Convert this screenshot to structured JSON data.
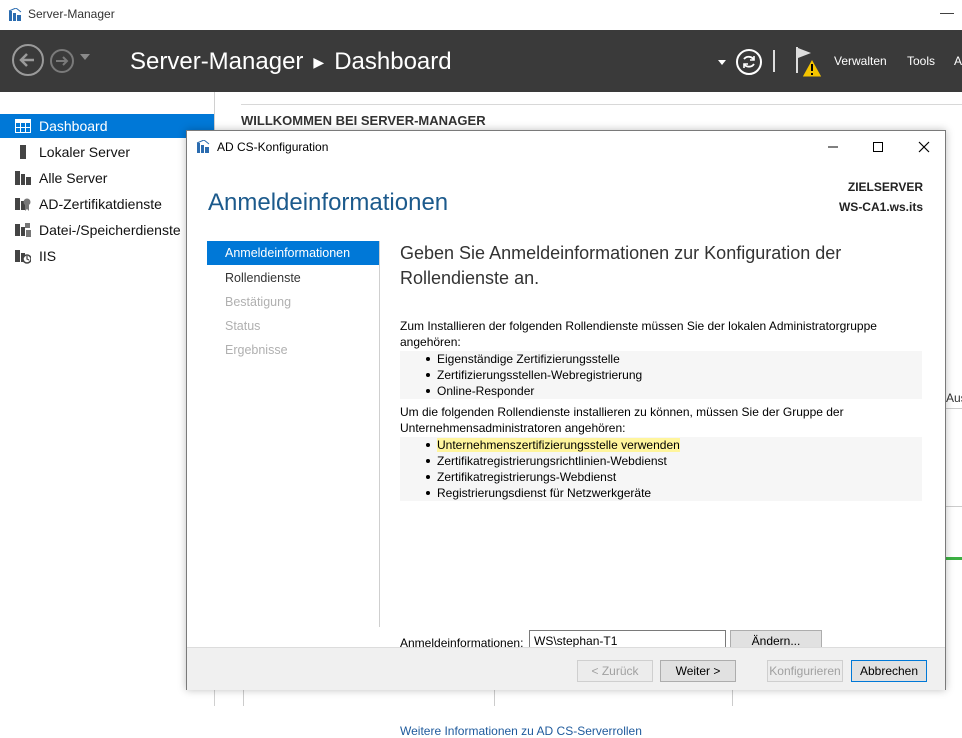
{
  "outer_window": {
    "title": "Server-Manager"
  },
  "header": {
    "title": "Server-Manager",
    "breadcrumb": "Dashboard",
    "menu": [
      "Verwalten",
      "Tools",
      "A"
    ]
  },
  "leftnav": {
    "items": [
      {
        "label": "Dashboard",
        "icon": "dashboard-icon",
        "active": true
      },
      {
        "label": "Lokaler Server",
        "icon": "server-icon"
      },
      {
        "label": "Alle Server",
        "icon": "servers-icon"
      },
      {
        "label": "AD-Zertifikatdienste",
        "icon": "certificate-icon"
      },
      {
        "label": "Datei-/Speicherdienste",
        "icon": "storage-icon"
      },
      {
        "label": "IIS",
        "icon": "iis-icon"
      }
    ]
  },
  "background": {
    "welcome": "WILLKOMMEN BEI SERVER-MANAGER",
    "right_fragment": "Aus"
  },
  "dialog": {
    "title": "AD CS-Konfiguration",
    "heading": "Anmeldeinformationen",
    "target_label": "ZIELSERVER",
    "target_value": "WS-CA1.ws.its",
    "steps": [
      {
        "label": "Anmeldeinformationen",
        "state": "active"
      },
      {
        "label": "Rollendienste",
        "state": "normal"
      },
      {
        "label": "Bestätigung",
        "state": "disabled"
      },
      {
        "label": "Status",
        "state": "disabled"
      },
      {
        "label": "Ergebnisse",
        "state": "disabled"
      }
    ],
    "lead": "Geben Sie Anmeldeinformationen zur Konfiguration der Rollendienste an.",
    "para1": "Zum Installieren der folgenden Rollendienste müssen Sie der lokalen Administratorgruppe angehören:",
    "list1": [
      "Eigenständige Zertifizierungsstelle",
      "Zertifizierungsstellen-Webregistrierung",
      "Online-Responder"
    ],
    "para2": "Um die folgenden Rollendienste installieren zu können, müssen Sie der Gruppe der Unternehmensadministratoren angehören:",
    "list2": [
      "Unternehmenszertifizierungsstelle verwenden",
      "Zertifikatregistrierungsrichtlinien-Webdienst",
      "Zertifikatregistrierungs-Webdienst",
      "Registrierungsdienst für Netzwerkgeräte"
    ],
    "credentials_label": "Anmeldeinformationen:",
    "credentials_value": "WS\\stephan-T1",
    "change_button": "Ändern...",
    "more_link": "Weitere Informationen zu AD CS-Serverrollen",
    "buttons": {
      "back": "< Zurück",
      "next": "Weiter >",
      "configure": "Konfigurieren",
      "cancel": "Abbrechen"
    }
  },
  "colors": {
    "accent": "#0078d7",
    "header_bg": "#3a3a3a",
    "heading": "#1c5a8c",
    "highlight": "#fff59d",
    "warning": "#f5c400"
  }
}
